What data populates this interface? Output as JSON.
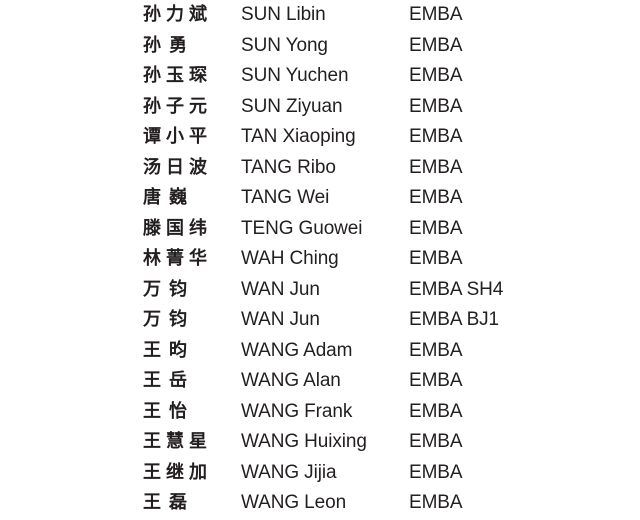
{
  "roster": [
    {
      "chinese_name": "孙力斌",
      "english_name": "SUN Libin",
      "program": "EMBA"
    },
    {
      "chinese_name": "孙 勇",
      "english_name": "SUN Yong",
      "program": "EMBA"
    },
    {
      "chinese_name": "孙玉琛",
      "english_name": "SUN Yuchen",
      "program": "EMBA"
    },
    {
      "chinese_name": "孙子元",
      "english_name": "SUN Ziyuan",
      "program": "EMBA"
    },
    {
      "chinese_name": "谭小平",
      "english_name": "TAN Xiaoping",
      "program": "EMBA"
    },
    {
      "chinese_name": "汤日波",
      "english_name": "TANG Ribo",
      "program": "EMBA"
    },
    {
      "chinese_name": "唐 巍",
      "english_name": "TANG Wei",
      "program": "EMBA"
    },
    {
      "chinese_name": "滕国纬",
      "english_name": "TENG Guowei",
      "program": "EMBA"
    },
    {
      "chinese_name": "林菁华",
      "english_name": "WAH Ching",
      "program": "EMBA"
    },
    {
      "chinese_name": "万 钧",
      "english_name": "WAN Jun",
      "program": "EMBA SH4"
    },
    {
      "chinese_name": "万 钧",
      "english_name": "WAN Jun",
      "program": "EMBA BJ1"
    },
    {
      "chinese_name": "王 昀",
      "english_name": "WANG Adam",
      "program": "EMBA"
    },
    {
      "chinese_name": "王 岳",
      "english_name": "WANG Alan",
      "program": "EMBA"
    },
    {
      "chinese_name": "王 怡",
      "english_name": "WANG Frank",
      "program": "EMBA"
    },
    {
      "chinese_name": "王慧星",
      "english_name": "WANG Huixing",
      "program": "EMBA"
    },
    {
      "chinese_name": "王继加",
      "english_name": "WANG Jijia",
      "program": "EMBA"
    },
    {
      "chinese_name": "王 磊",
      "english_name": "WANG Leon",
      "program": "EMBA"
    }
  ]
}
